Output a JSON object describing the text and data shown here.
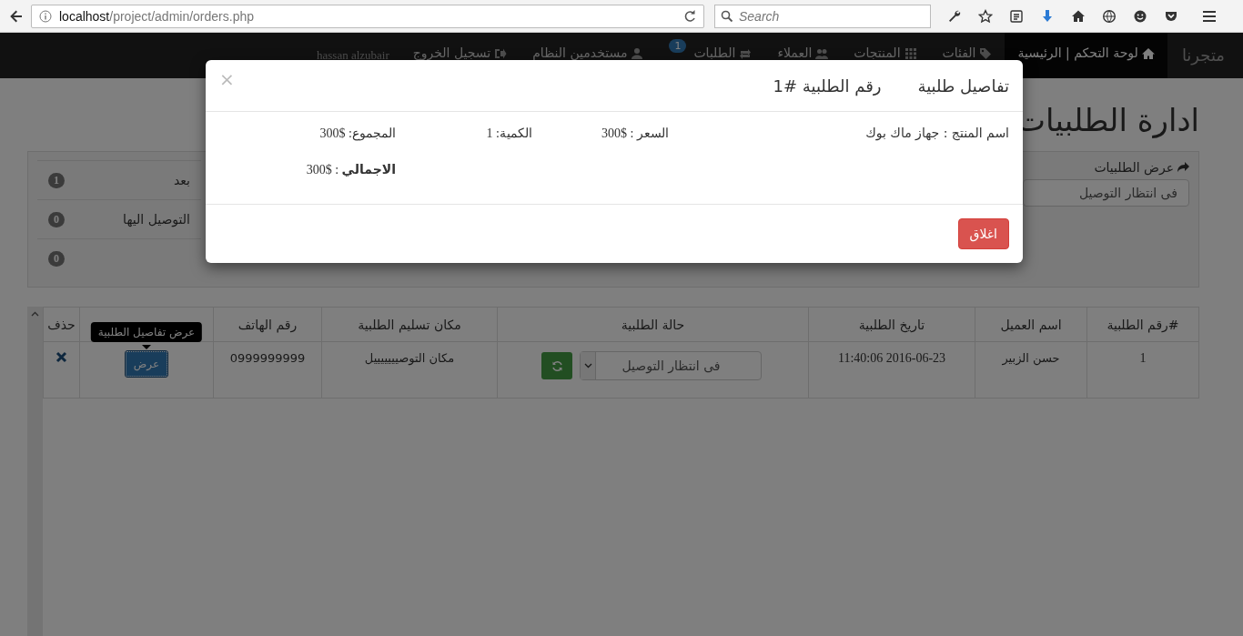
{
  "browser": {
    "url_host": "localhost",
    "url_path": "/project/admin/orders.php",
    "search_placeholder": "Search"
  },
  "navbar": {
    "brand": "متجرنا",
    "items": [
      {
        "label": "لوحة التحكم | الرئيسية",
        "selected": true
      },
      {
        "label": "الفئات",
        "selected": false
      },
      {
        "label": "المنتجات",
        "selected": false
      },
      {
        "label": "العملاء",
        "selected": false
      },
      {
        "label": "الطلبات",
        "badge": "1",
        "selected": false
      },
      {
        "label": "مستخدمين النظام",
        "selected": false
      },
      {
        "label": "تسجيل الخروج",
        "selected": false
      }
    ],
    "user": "hassan alzubair"
  },
  "page": {
    "title": "ادارة الطلبيات"
  },
  "filter_panel": {
    "heading": "عرض الطلبيات",
    "status_select": "فى انتظار التوصيل",
    "counts": [
      {
        "label": "بعد",
        "count": "1"
      },
      {
        "label": "التوصيل اليها",
        "count": "0"
      },
      {
        "count": "0"
      }
    ]
  },
  "table": {
    "columns": [
      {
        "label": "#رقم الطلبية"
      },
      {
        "label": "اسم العميل"
      },
      {
        "label": "تاريخ الطلبية"
      },
      {
        "label": "حالة الطلبية"
      },
      {
        "label": "مكان تسليم الطلبية"
      },
      {
        "label": "رقم الهاتف"
      },
      {},
      {
        "label": "حذف"
      }
    ],
    "rows": [
      {
        "order_no": "1",
        "customer": "حسن الزبير",
        "date": "2016-06-23 11:40:06",
        "status": "فى انتظار التوصيل",
        "address": "مكان التوصيييييييل",
        "phone": "0999999999",
        "details_button": "عرض",
        "tooltip": "عرض تفاصيل الطلبية"
      }
    ]
  },
  "modal": {
    "title": "تفاصيل طلبية",
    "order_label": "رقم الطلبية #1",
    "close": "×",
    "items": [
      {
        "product": "اسم المنتج : جهاز ماك بوك",
        "price": "السعر : $300",
        "quantity": "الكمية: 1",
        "subtotal": "المجموع: $300"
      }
    ],
    "total": "**الاجمالي** : $300",
    "close_button": "اغلاق"
  }
}
